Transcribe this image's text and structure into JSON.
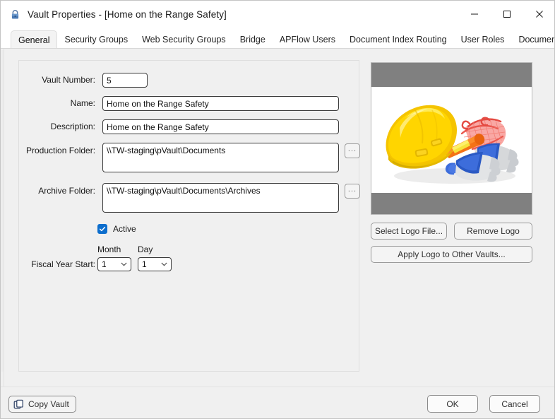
{
  "window": {
    "title": "Vault Properties - [Home on the Range Safety]",
    "icon": "lock-icon",
    "controls": {
      "minimize": "minimize-icon",
      "maximize": "maximize-icon",
      "close": "close-icon"
    }
  },
  "tabs": [
    {
      "label": "General",
      "active": true
    },
    {
      "label": "Security Groups",
      "active": false
    },
    {
      "label": "Web Security Groups",
      "active": false
    },
    {
      "label": "Bridge",
      "active": false
    },
    {
      "label": "APFlow Users",
      "active": false
    },
    {
      "label": "Document Index Routing",
      "active": false
    },
    {
      "label": "User Roles",
      "active": false
    },
    {
      "label": "Document Publishing",
      "active": false
    }
  ],
  "form": {
    "vault_number": {
      "label": "Vault Number:",
      "value": "5"
    },
    "name": {
      "label": "Name:",
      "value": "Home on the Range Safety"
    },
    "description": {
      "label": "Description:",
      "value": "Home on the Range Safety"
    },
    "production_folder": {
      "label": "Production Folder:",
      "value": "\\\\TW-staging\\pVault\\Documents",
      "browse_label": "..."
    },
    "archive_folder": {
      "label": "Archive Folder:",
      "value": "\\\\TW-staging\\pVault\\Documents\\Archives",
      "browse_label": "..."
    },
    "active": {
      "label": "Active",
      "checked": true
    },
    "fiscal_year_start": {
      "label": "Fiscal Year Start:",
      "month_header": "Month",
      "day_header": "Day",
      "month_value": "1",
      "day_value": "1"
    }
  },
  "logo_panel": {
    "image_alt": "safety-equipment-hard-hat-gloves-cone",
    "select_logo_label": "Select Logo File...",
    "remove_logo_label": "Remove Logo",
    "apply_logo_label": "Apply Logo to Other Vaults..."
  },
  "footer": {
    "copy_vault_label": "Copy Vault",
    "ok_label": "OK",
    "cancel_label": "Cancel"
  },
  "colors": {
    "accent": "#0d6ecd",
    "titlebar_bg": "#ffffff",
    "dialog_bg": "#f0f0f0",
    "logo_matte": "#808080",
    "hardhat_yellow": "#f5c400",
    "cone_orange": "#f47216",
    "glove_blue": "#2a59c4",
    "mesh_red": "#ee3b3b"
  }
}
